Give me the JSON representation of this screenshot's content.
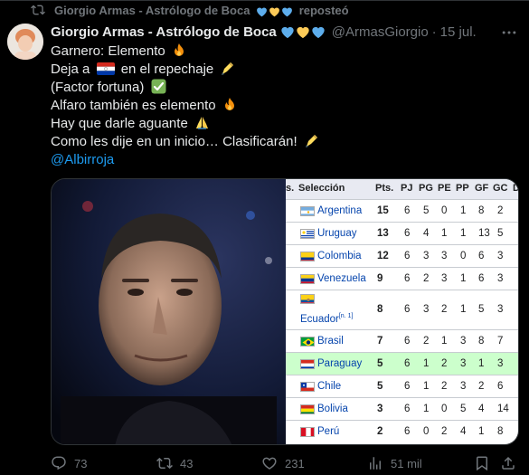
{
  "repost": {
    "name": "Giorgio Armas - Astrólogo de Boca",
    "suffix": "reposteó"
  },
  "tweet": {
    "name": "Giorgio Armas - Astrólogo de Boca",
    "handle": "@ArmasGiorgio",
    "separator": "·",
    "date": "15 jul.",
    "lines": [
      "Garnero: Elemento",
      "Deja a",
      "en el repechaje",
      "(Factor fortuna)",
      "Alfaro también es elemento",
      "Hay que darle aguante",
      "Como les dije en un inicio… Clasificarán!"
    ],
    "mention": "@Albirroja"
  },
  "table": {
    "headers": [
      "s.",
      "Selección",
      "Pts.",
      "PJ",
      "PG",
      "PE",
      "PP",
      "GF",
      "GC",
      "D"
    ],
    "rows": [
      {
        "team": "Argentina",
        "sup": "",
        "pts": "15",
        "pj": "6",
        "pg": "5",
        "pe": "0",
        "pp": "1",
        "gf": "8",
        "gc": "2",
        "flag": "argentina"
      },
      {
        "team": "Uruguay",
        "sup": "",
        "pts": "13",
        "pj": "6",
        "pg": "4",
        "pe": "1",
        "pp": "1",
        "gf": "13",
        "gc": "5",
        "flag": "uruguay"
      },
      {
        "team": "Colombia",
        "sup": "",
        "pts": "12",
        "pj": "6",
        "pg": "3",
        "pe": "3",
        "pp": "0",
        "gf": "6",
        "gc": "3",
        "flag": "colombia"
      },
      {
        "team": "Venezuela",
        "sup": "",
        "pts": "9",
        "pj": "6",
        "pg": "2",
        "pe": "3",
        "pp": "1",
        "gf": "6",
        "gc": "3",
        "flag": "venezuela"
      },
      {
        "team": "Ecuador",
        "sup": "[n. 1]",
        "pts": "8",
        "pj": "6",
        "pg": "3",
        "pe": "2",
        "pp": "1",
        "gf": "5",
        "gc": "3",
        "flag": "ecuador"
      },
      {
        "team": "Brasil",
        "sup": "",
        "pts": "7",
        "pj": "6",
        "pg": "2",
        "pe": "1",
        "pp": "3",
        "gf": "8",
        "gc": "7",
        "flag": "brasil"
      },
      {
        "team": "Paraguay",
        "sup": "",
        "pts": "5",
        "pj": "6",
        "pg": "1",
        "pe": "2",
        "pp": "3",
        "gf": "1",
        "gc": "3",
        "flag": "paraguay"
      },
      {
        "team": "Chile",
        "sup": "",
        "pts": "5",
        "pj": "6",
        "pg": "1",
        "pe": "2",
        "pp": "3",
        "gf": "2",
        "gc": "6",
        "flag": "chile"
      },
      {
        "team": "Bolivia",
        "sup": "",
        "pts": "3",
        "pj": "6",
        "pg": "1",
        "pe": "0",
        "pp": "5",
        "gf": "4",
        "gc": "14",
        "flag": "bolivia"
      },
      {
        "team": "Perú",
        "sup": "",
        "pts": "2",
        "pj": "6",
        "pg": "0",
        "pe": "2",
        "pp": "4",
        "gf": "1",
        "gc": "8",
        "flag": "peru"
      }
    ],
    "highlight_color": "#ccffcc",
    "header_color": "#e8eaf2"
  },
  "actions": {
    "replies": "73",
    "reposts": "43",
    "likes": "231",
    "views": "51 mil"
  },
  "colors": {
    "background": "#000000",
    "text": "#e7e9ea",
    "muted": "#71767b",
    "link": "#1d9bf0",
    "border": "#2f3336"
  },
  "icons": [
    "repost-icon",
    "blue-heart-icon",
    "yellow-heart-icon",
    "more-icon",
    "fire-icon",
    "writing-hand-icon",
    "check-mark-icon",
    "folded-hands-icon",
    "reply-icon",
    "like-icon",
    "views-icon",
    "bookmark-icon",
    "share-icon"
  ]
}
